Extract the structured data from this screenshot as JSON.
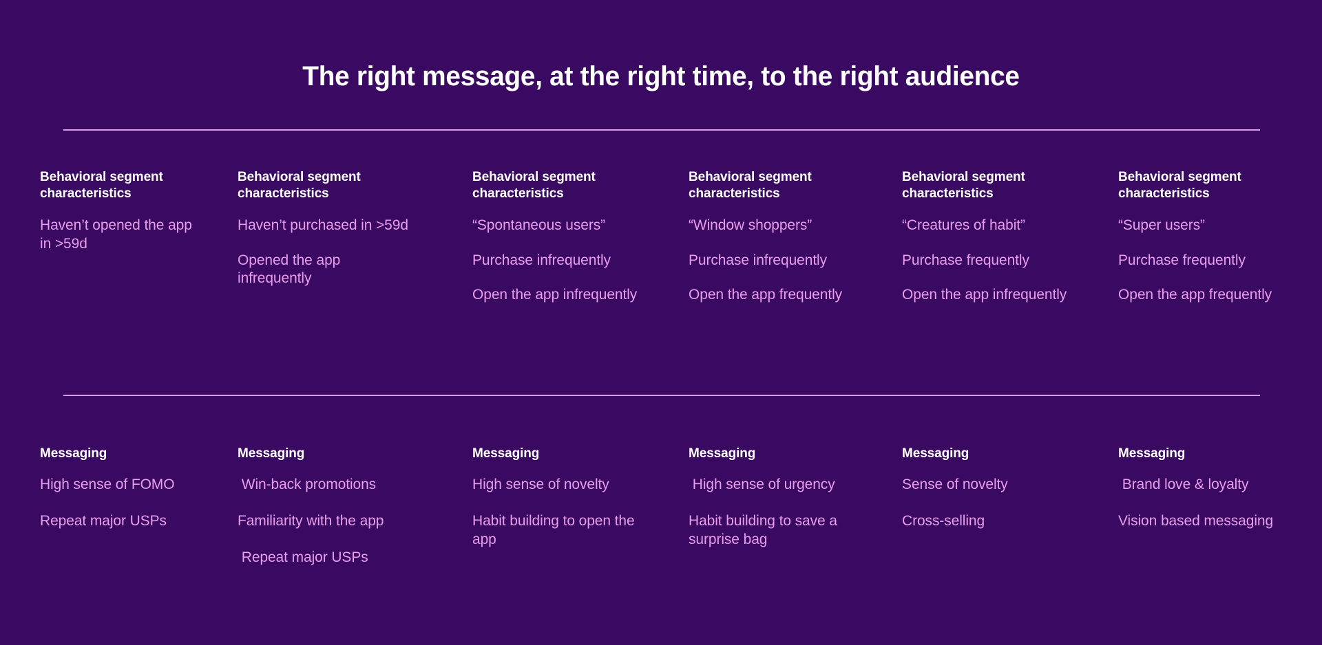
{
  "slide": {
    "title": "The right message, at the right time, to the right audience",
    "background_color": "#3A0A63",
    "heading_color": "#FFFFFF",
    "body_color": "#E89DEC",
    "divider_color": "#D89BE8"
  },
  "columns": [
    {
      "characteristics_heading": "Behavioral segment\ncharacteristics",
      "characteristics": [
        "Haven’t opened the app in >59d"
      ],
      "messaging_heading": "Messaging",
      "messaging": [
        "High sense of FOMO",
        "Repeat major USPs"
      ]
    },
    {
      "characteristics_heading": "Behavioral segment\ncharacteristics",
      "characteristics": [
        "Haven’t purchased in >59d",
        "Opened the app infrequently"
      ],
      "messaging_heading": "Messaging",
      "messaging": [
        " Win-back promotions",
        "Familiarity with the app",
        " Repeat major USPs"
      ]
    },
    {
      "characteristics_heading": "Behavioral segment\ncharacteristics",
      "characteristics": [
        "“Spontaneous users”",
        "Purchase infrequently",
        "Open the app infrequently"
      ],
      "messaging_heading": "Messaging",
      "messaging": [
        "High sense of novelty",
        "Habit building to open the app"
      ]
    },
    {
      "characteristics_heading": "Behavioral segment\ncharacteristics",
      "characteristics": [
        "“Window shoppers”",
        "Purchase infrequently",
        "Open the app frequently"
      ],
      "messaging_heading": "Messaging",
      "messaging": [
        " High sense of urgency",
        "Habit building to save a surprise bag"
      ]
    },
    {
      "characteristics_heading": "Behavioral segment\ncharacteristics",
      "characteristics": [
        "“Creatures of habit”",
        "Purchase frequently",
        "Open the app infrequently"
      ],
      "messaging_heading": "Messaging",
      "messaging": [
        "Sense of novelty",
        "Cross-selling"
      ]
    },
    {
      "characteristics_heading": "Behavioral segment\ncharacteristics",
      "characteristics": [
        "“Super users”",
        "Purchase frequently",
        "Open the app frequently"
      ],
      "messaging_heading": "Messaging",
      "messaging": [
        " Brand love & loyalty",
        "Vision based messaging"
      ]
    }
  ]
}
